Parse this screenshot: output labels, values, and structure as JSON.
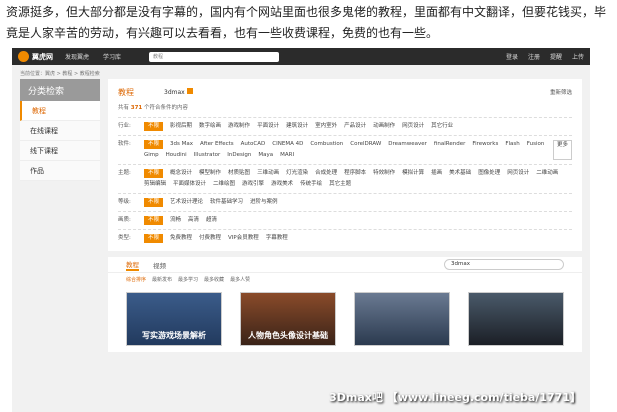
{
  "intro_text": "资源挺多，但大部分都是没有字幕的，国内有个网站里面也很多鬼佬的教程，里面都有中文翻译，但要花钱买，毕竟是人家辛苦的劳动，有兴趣可以去看看，也有一些收费课程，免费的也有一些。",
  "navbar": {
    "logo_text": "翼虎网",
    "items": [
      "发现翼虎",
      "学习库"
    ],
    "search_placeholder": "教程",
    "right": [
      "登录",
      "注册",
      "提醒",
      "上传"
    ]
  },
  "breadcrumb": "当前位置：翼虎 > 教程 > 教程检索",
  "sidebar": {
    "header": "分类检索",
    "items": [
      "教程",
      "在线课程",
      "线下课程",
      "作品"
    ],
    "active_index": 0
  },
  "panel": {
    "title": "教程",
    "active_tag": "3dmax",
    "reset_label": "重新筛选",
    "count_prefix": "共有",
    "count": "371",
    "count_suffix": "个符合条件的内容",
    "filters": [
      {
        "label": "行业:",
        "options": [
          "不限",
          "影视后期",
          "数字绘画",
          "游戏制作",
          "平面设计",
          "建筑设计",
          "室内室外",
          "产品设计",
          "动画制作",
          "网页设计",
          "其它行业"
        ]
      },
      {
        "label": "软件:",
        "options": [
          "不限",
          "3ds Max",
          "After Effects",
          "AutoCAD",
          "CINEMA 4D",
          "Combustion",
          "CorelDRAW",
          "Dreamweaver",
          "finalRender",
          "Fireworks",
          "Flash",
          "Fusion",
          "Gimp",
          "Houdini",
          "Illustrator",
          "InDesign",
          "Maya",
          "MARI"
        ],
        "more": "更多"
      },
      {
        "label": "主题:",
        "options": [
          "不限",
          "概念设计",
          "模型制作",
          "材质贴图",
          "三维动画",
          "灯光渲染",
          "合成处理",
          "程序脚本",
          "特效制作",
          "模拟计算",
          "插画",
          "美术基础",
          "图像处理",
          "网页设计",
          "二维动画",
          "剪辑编辑",
          "平面媒体设计",
          "二维绘图",
          "游戏引擎",
          "游戏美术",
          "传统手绘",
          "其它主题"
        ]
      },
      {
        "label": "等级:",
        "options": [
          "不限",
          "艺术设计理论",
          "软件基础学习",
          "进阶与案例"
        ]
      },
      {
        "label": "画质:",
        "options": [
          "不限",
          "流畅",
          "高清",
          "超清"
        ]
      },
      {
        "label": "类型:",
        "options": [
          "不限",
          "免费教程",
          "付费教程",
          "VIP会员教程",
          "字幕教程"
        ]
      }
    ]
  },
  "bottom": {
    "tabs": [
      "教程",
      "视频"
    ],
    "search_value": "3dmax",
    "sorts": [
      "综合排序",
      "最新发布",
      "最多学习",
      "最多收藏",
      "最多人赞"
    ],
    "thumbs": [
      "写实游戏场景解析",
      "人物角色头像设计基础",
      "",
      ""
    ]
  },
  "watermark": "3Dmax吧 【www.lineeg.com/tieba/1771】"
}
